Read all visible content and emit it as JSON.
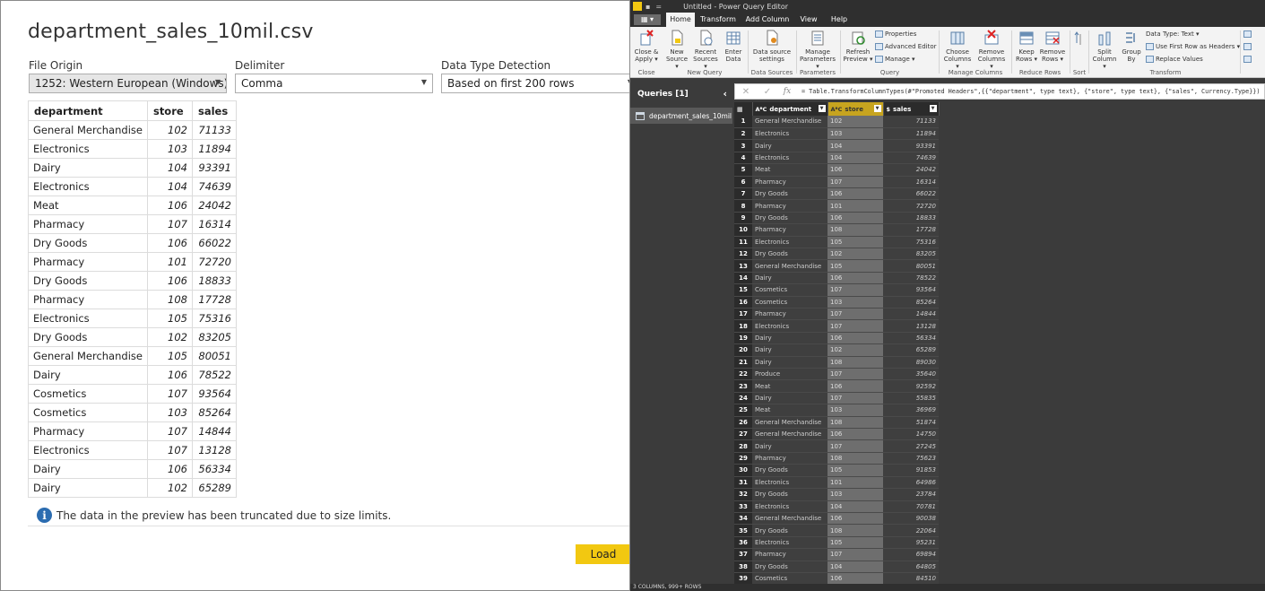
{
  "dialog": {
    "title": "department_sales_10mil.csv",
    "file_origin": {
      "label": "File Origin",
      "value": "1252: Western European (Windows)"
    },
    "delimiter": {
      "label": "Delimiter",
      "value": "Comma"
    },
    "detection": {
      "label": "Data Type Detection",
      "value": "Based on first 200 rows"
    },
    "columns": [
      "department",
      "store",
      "sales"
    ],
    "rows": [
      [
        "General Merchandise",
        "102",
        "71133"
      ],
      [
        "Electronics",
        "103",
        "11894"
      ],
      [
        "Dairy",
        "104",
        "93391"
      ],
      [
        "Electronics",
        "104",
        "74639"
      ],
      [
        "Meat",
        "106",
        "24042"
      ],
      [
        "Pharmacy",
        "107",
        "16314"
      ],
      [
        "Dry Goods",
        "106",
        "66022"
      ],
      [
        "Pharmacy",
        "101",
        "72720"
      ],
      [
        "Dry Goods",
        "106",
        "18833"
      ],
      [
        "Pharmacy",
        "108",
        "17728"
      ],
      [
        "Electronics",
        "105",
        "75316"
      ],
      [
        "Dry Goods",
        "102",
        "83205"
      ],
      [
        "General Merchandise",
        "105",
        "80051"
      ],
      [
        "Dairy",
        "106",
        "78522"
      ],
      [
        "Cosmetics",
        "107",
        "93564"
      ],
      [
        "Cosmetics",
        "103",
        "85264"
      ],
      [
        "Pharmacy",
        "107",
        "14844"
      ],
      [
        "Electronics",
        "107",
        "13128"
      ],
      [
        "Dairy",
        "106",
        "56334"
      ],
      [
        "Dairy",
        "102",
        "65289"
      ]
    ],
    "truncation_note": "The data in the preview has been truncated due to size limits.",
    "load_label": "Load"
  },
  "pq": {
    "window_title": "Untitled - Power Query Editor",
    "file_tab": "▦ ▾",
    "tabs": [
      "Home",
      "Transform",
      "Add Column",
      "View",
      "Help"
    ],
    "ribbon": {
      "close_apply": "Close & Apply ▾",
      "new_source": "New Source ▾",
      "recent_sources": "Recent Sources ▾",
      "enter_data": "Enter Data",
      "data_source_settings": "Data source settings",
      "manage_parameters": "Manage Parameters ▾",
      "refresh_preview": "Refresh Preview ▾",
      "properties": "Properties",
      "advanced_editor": "Advanced Editor",
      "manage": "Manage ▾",
      "choose_columns": "Choose Columns ▾",
      "remove_columns": "Remove Columns ▾",
      "keep_rows": "Keep Rows ▾",
      "remove_rows": "Remove Rows ▾",
      "split_column": "Split Column ▾",
      "group_by": "Group By",
      "data_type": "Data Type: Text ▾",
      "use_first_row": "Use First Row as Headers ▾",
      "replace_values": "Replace Values",
      "groups": [
        "Close",
        "New Query",
        "Data Sources",
        "Parameters",
        "Query",
        "Manage Columns",
        "Reduce Rows",
        "Sort",
        "Transform"
      ]
    },
    "queries_title": "Queries [1]",
    "query_name": "department_sales_10mil",
    "formula": "= Table.TransformColumnTypes(#\"Promoted Headers\",{{\"department\", type text}, {\"store\", type text}, {\"sales\", Currency.Type}})",
    "grid_columns": [
      {
        "type_icon": "AᴮC",
        "name": "department"
      },
      {
        "type_icon": "AᴮC",
        "name": "store"
      },
      {
        "type_icon": "$",
        "name": "sales"
      }
    ],
    "grid_rows": [
      [
        "1",
        "General Merchandise",
        "102",
        "71133"
      ],
      [
        "2",
        "Electronics",
        "103",
        "11894"
      ],
      [
        "3",
        "Dairy",
        "104",
        "93391"
      ],
      [
        "4",
        "Electronics",
        "104",
        "74639"
      ],
      [
        "5",
        "Meat",
        "106",
        "24042"
      ],
      [
        "6",
        "Pharmacy",
        "107",
        "16314"
      ],
      [
        "7",
        "Dry Goods",
        "106",
        "66022"
      ],
      [
        "8",
        "Pharmacy",
        "101",
        "72720"
      ],
      [
        "9",
        "Dry Goods",
        "106",
        "18833"
      ],
      [
        "10",
        "Pharmacy",
        "108",
        "17728"
      ],
      [
        "11",
        "Electronics",
        "105",
        "75316"
      ],
      [
        "12",
        "Dry Goods",
        "102",
        "83205"
      ],
      [
        "13",
        "General Merchandise",
        "105",
        "80051"
      ],
      [
        "14",
        "Dairy",
        "106",
        "78522"
      ],
      [
        "15",
        "Cosmetics",
        "107",
        "93564"
      ],
      [
        "16",
        "Cosmetics",
        "103",
        "85264"
      ],
      [
        "17",
        "Pharmacy",
        "107",
        "14844"
      ],
      [
        "18",
        "Electronics",
        "107",
        "13128"
      ],
      [
        "19",
        "Dairy",
        "106",
        "56334"
      ],
      [
        "20",
        "Dairy",
        "102",
        "65289"
      ],
      [
        "21",
        "Dairy",
        "108",
        "89030"
      ],
      [
        "22",
        "Produce",
        "107",
        "35640"
      ],
      [
        "23",
        "Meat",
        "106",
        "92592"
      ],
      [
        "24",
        "Dairy",
        "107",
        "55835"
      ],
      [
        "25",
        "Meat",
        "103",
        "36969"
      ],
      [
        "26",
        "General Merchandise",
        "108",
        "51874"
      ],
      [
        "27",
        "General Merchandise",
        "106",
        "14750"
      ],
      [
        "28",
        "Dairy",
        "107",
        "27245"
      ],
      [
        "29",
        "Pharmacy",
        "108",
        "75623"
      ],
      [
        "30",
        "Dry Goods",
        "105",
        "91853"
      ],
      [
        "31",
        "Electronics",
        "101",
        "64986"
      ],
      [
        "32",
        "Dry Goods",
        "103",
        "23784"
      ],
      [
        "33",
        "Electronics",
        "104",
        "70781"
      ],
      [
        "34",
        "General Merchandise",
        "106",
        "90038"
      ],
      [
        "35",
        "Dry Goods",
        "108",
        "22064"
      ],
      [
        "36",
        "Electronics",
        "105",
        "95231"
      ],
      [
        "37",
        "Pharmacy",
        "107",
        "69894"
      ],
      [
        "38",
        "Dry Goods",
        "104",
        "64805"
      ],
      [
        "39",
        "Cosmetics",
        "106",
        "84510"
      ]
    ],
    "status": "3 COLUMNS, 999+ ROWS"
  }
}
